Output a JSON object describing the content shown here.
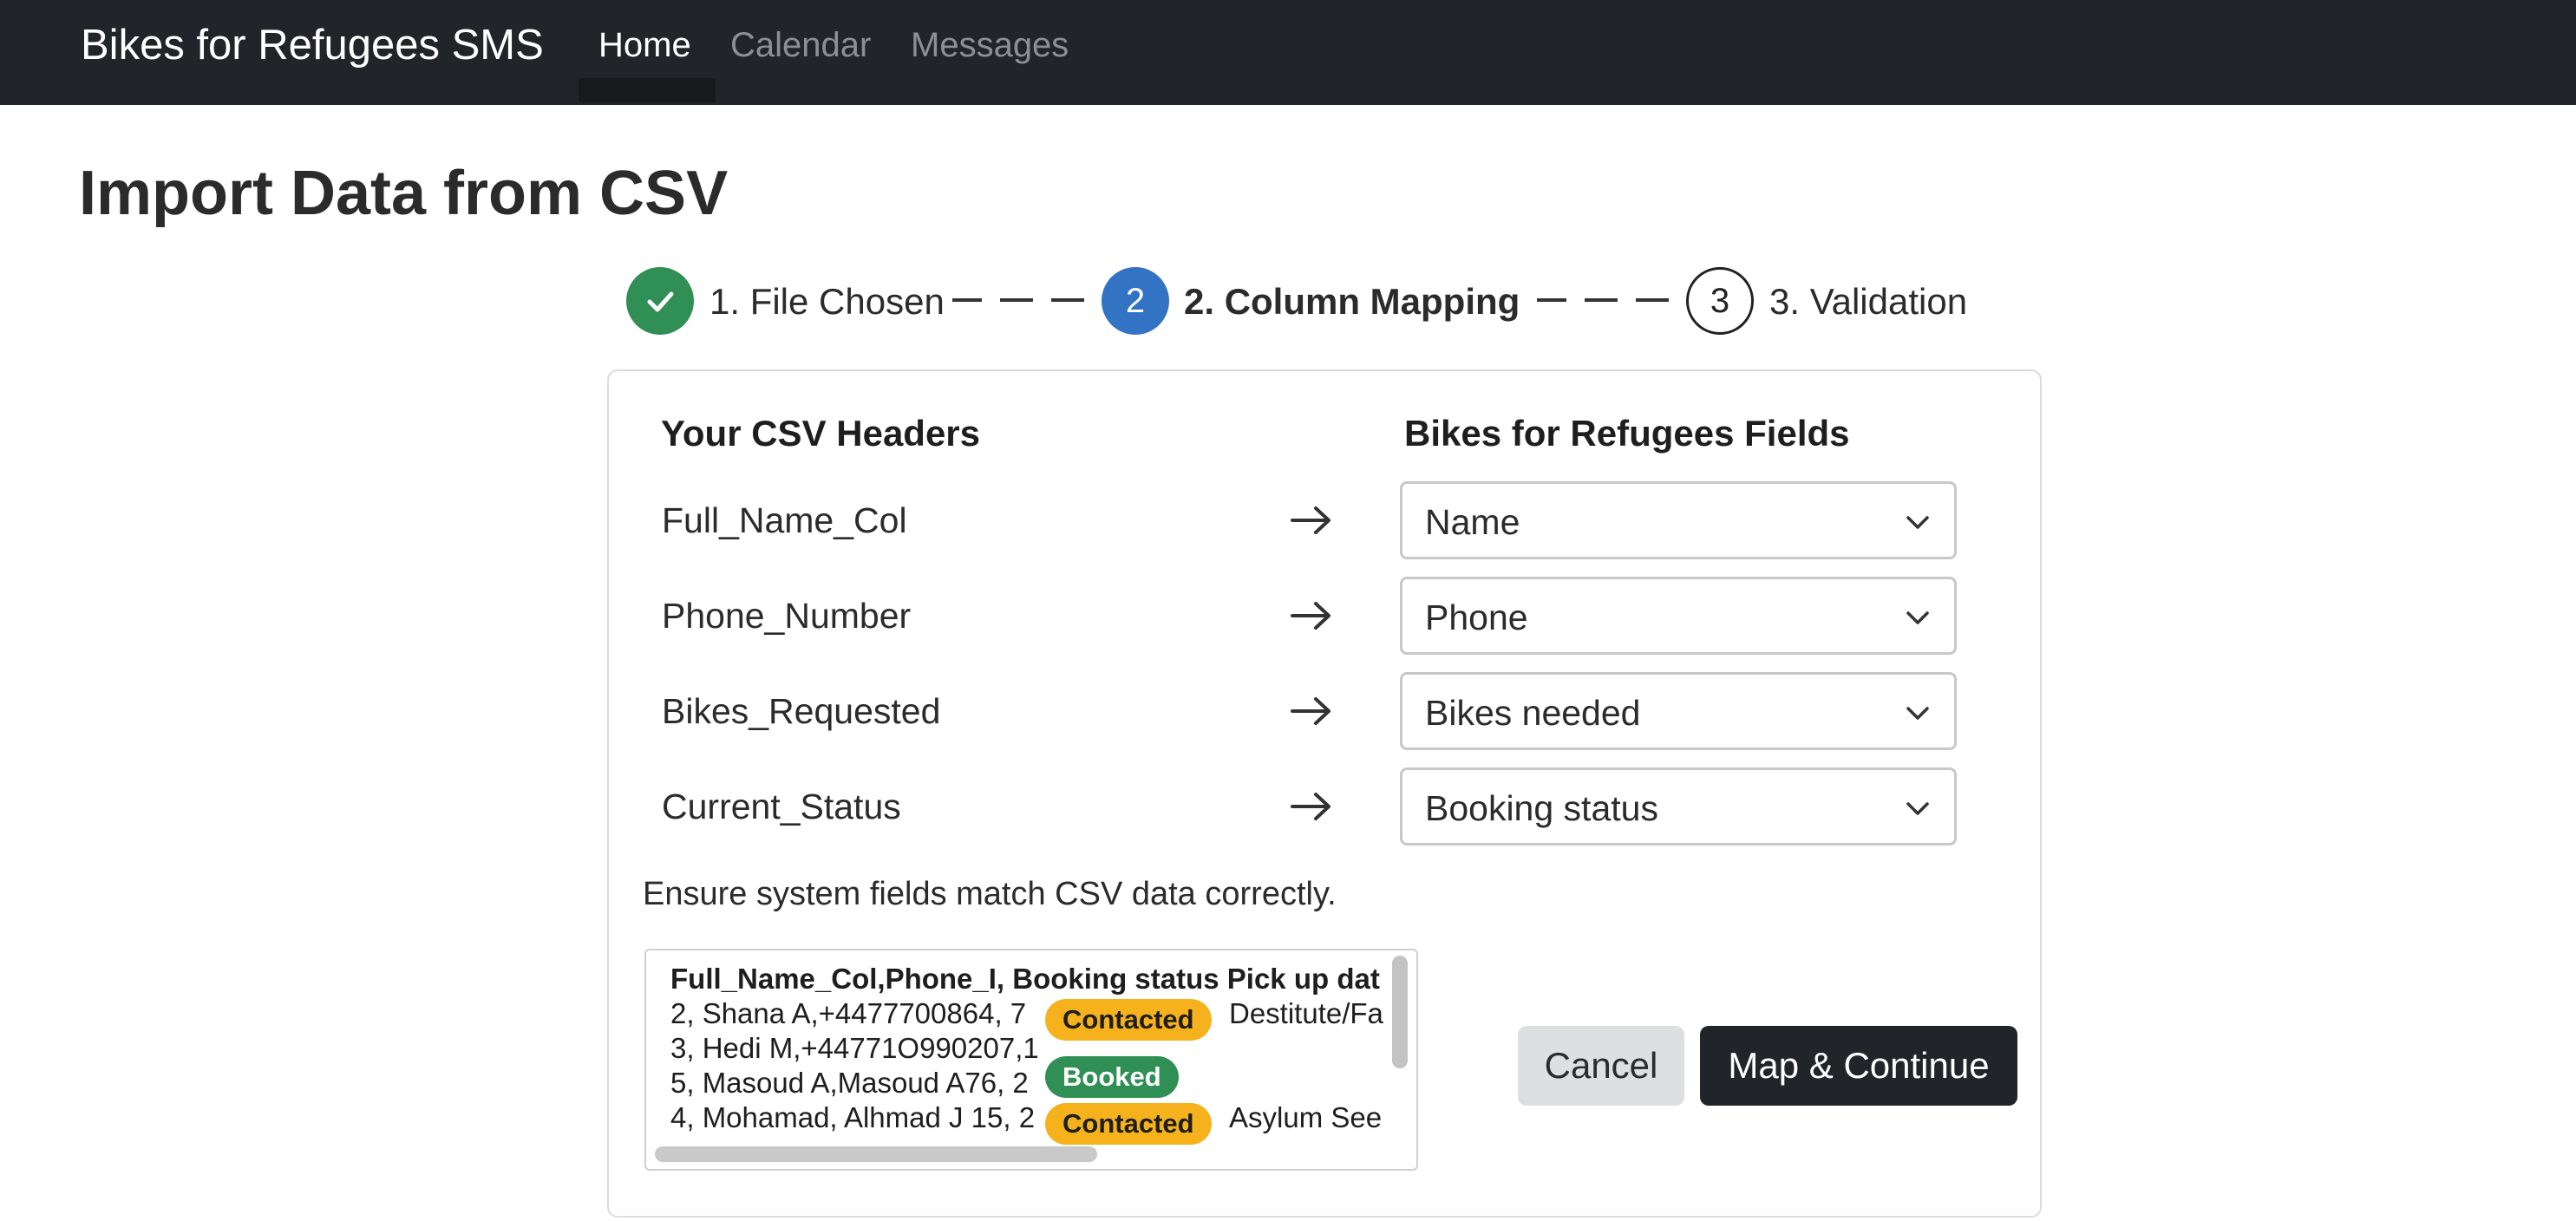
{
  "navbar": {
    "brand": "Bikes for Refugees SMS",
    "links": [
      {
        "label": "Home",
        "active": true
      },
      {
        "label": "Calendar",
        "active": false
      },
      {
        "label": "Messages",
        "active": false
      }
    ]
  },
  "page": {
    "title": "Import Data from CSV"
  },
  "stepper": {
    "steps": [
      {
        "number": "1",
        "label": "1. File Chosen",
        "state": "done"
      },
      {
        "number": "2",
        "label": "2. Column Mapping",
        "state": "active"
      },
      {
        "number": "3",
        "label": "3. Validation",
        "state": "todo"
      }
    ]
  },
  "mapping": {
    "left_header": "Your CSV Headers",
    "right_header": "Bikes for Refugees Fields",
    "rows": [
      {
        "csv_header": "Full_Name_Col",
        "field": "Name"
      },
      {
        "csv_header": "Phone_Number",
        "field": "Phone"
      },
      {
        "csv_header": "Bikes_Requested",
        "field": "Bikes needed"
      },
      {
        "csv_header": "Current_Status",
        "field": "Booking status"
      }
    ],
    "hint": "Ensure system fields match CSV data correctly."
  },
  "preview": {
    "header": "Full_Name_Col,Phone_I, Booking status Pick up dat",
    "rows": [
      {
        "text": "2, Shana A,+4477700864, 7",
        "badge": "Contacted",
        "trail": "Destitute/Fa"
      },
      {
        "text": "3, Hedi M,+44771O990207,1",
        "badge": "",
        "trail": ""
      },
      {
        "text": "5, Masoud A,Masoud A76, 2",
        "badge": "Booked",
        "trail": ""
      },
      {
        "text": "4, Mohamad, Alhmad J 15, 2",
        "badge": "Contacted",
        "trail": "Asylum See"
      }
    ]
  },
  "actions": {
    "cancel_label": "Cancel",
    "continue_label": "Map & Continue"
  },
  "colors": {
    "navbar": "#212529",
    "step_done": "#2f8f55",
    "step_active": "#3373c4",
    "badge_contacted": "#f6b21d",
    "badge_booked": "#2f8f55",
    "primary_button": "#212529"
  }
}
